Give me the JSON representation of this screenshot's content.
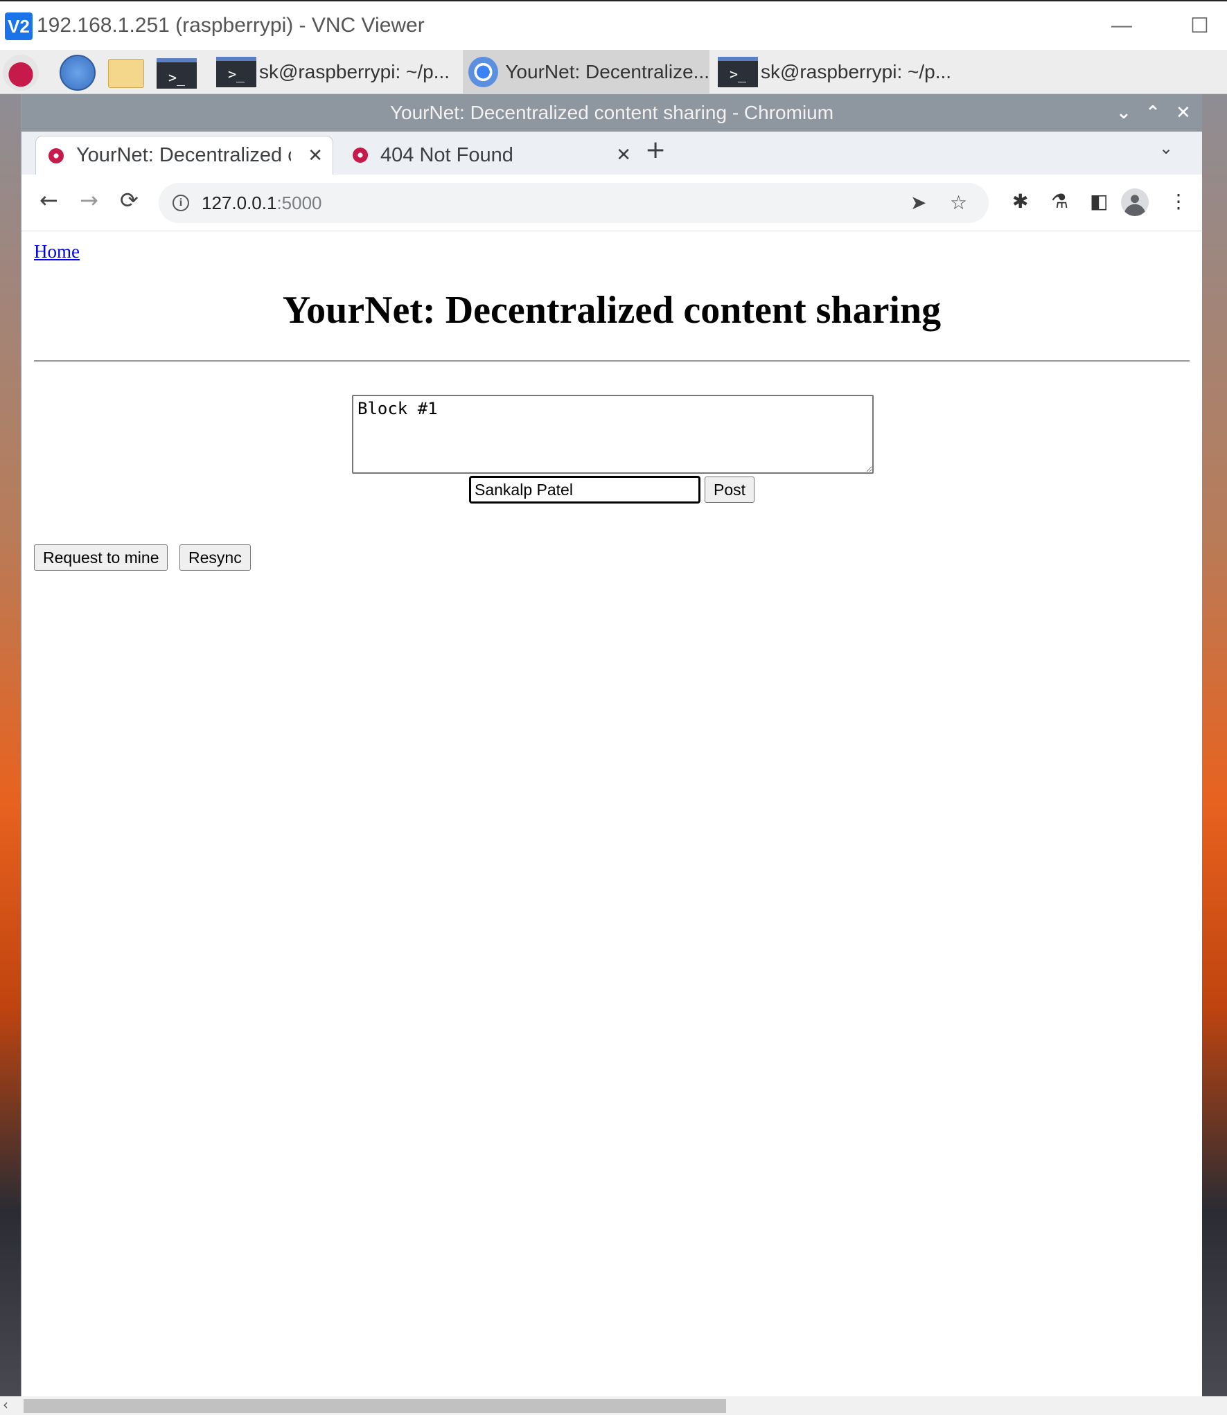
{
  "vnc": {
    "logo": "V2",
    "title": "192.168.1.251 (raspberrypi) - VNC Viewer",
    "minimize": "—",
    "maximize": "☐"
  },
  "taskbar": {
    "term_glyph": ">_",
    "tasks": [
      {
        "label": "sk@raspberrypi: ~/p..."
      },
      {
        "label": "YourNet: Decentralize..."
      },
      {
        "label": "sk@raspberrypi: ~/p..."
      }
    ]
  },
  "browser": {
    "window_title": "YourNet: Decentralized content sharing - Chromium",
    "tabs": [
      {
        "label": "YourNet: Decentralized co",
        "close": "✕"
      },
      {
        "label": "404 Not Found",
        "close": "✕"
      }
    ],
    "new_tab": "+",
    "url_host": "127.0.0.1",
    "url_port": ":5000",
    "info_glyph": "i"
  },
  "page": {
    "home_link": "Home",
    "title": "YourNet: Decentralized content sharing",
    "textarea_value": "Block #1",
    "name_input_value": "Sankalp Patel",
    "post_button": "Post",
    "request_button": "Request to mine",
    "resync_button": "Resync"
  },
  "colors": {
    "link": "#0000ee",
    "chromium_titlebar": "#8e969f",
    "vnc_logo": "#1a73e8"
  }
}
